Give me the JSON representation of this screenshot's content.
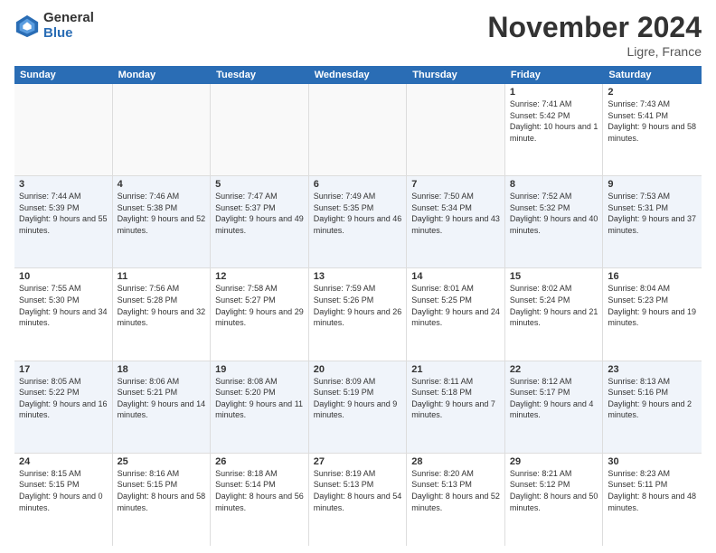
{
  "header": {
    "logo_general": "General",
    "logo_blue": "Blue",
    "month": "November 2024",
    "location": "Ligre, France"
  },
  "calendar": {
    "days": [
      "Sunday",
      "Monday",
      "Tuesday",
      "Wednesday",
      "Thursday",
      "Friday",
      "Saturday"
    ],
    "rows": [
      [
        {
          "day": "",
          "text": "",
          "empty": true
        },
        {
          "day": "",
          "text": "",
          "empty": true
        },
        {
          "day": "",
          "text": "",
          "empty": true
        },
        {
          "day": "",
          "text": "",
          "empty": true
        },
        {
          "day": "",
          "text": "",
          "empty": true
        },
        {
          "day": "1",
          "text": "Sunrise: 7:41 AM\nSunset: 5:42 PM\nDaylight: 10 hours and 1 minute.",
          "empty": false
        },
        {
          "day": "2",
          "text": "Sunrise: 7:43 AM\nSunset: 5:41 PM\nDaylight: 9 hours and 58 minutes.",
          "empty": false
        }
      ],
      [
        {
          "day": "3",
          "text": "Sunrise: 7:44 AM\nSunset: 5:39 PM\nDaylight: 9 hours and 55 minutes.",
          "empty": false
        },
        {
          "day": "4",
          "text": "Sunrise: 7:46 AM\nSunset: 5:38 PM\nDaylight: 9 hours and 52 minutes.",
          "empty": false
        },
        {
          "day": "5",
          "text": "Sunrise: 7:47 AM\nSunset: 5:37 PM\nDaylight: 9 hours and 49 minutes.",
          "empty": false
        },
        {
          "day": "6",
          "text": "Sunrise: 7:49 AM\nSunset: 5:35 PM\nDaylight: 9 hours and 46 minutes.",
          "empty": false
        },
        {
          "day": "7",
          "text": "Sunrise: 7:50 AM\nSunset: 5:34 PM\nDaylight: 9 hours and 43 minutes.",
          "empty": false
        },
        {
          "day": "8",
          "text": "Sunrise: 7:52 AM\nSunset: 5:32 PM\nDaylight: 9 hours and 40 minutes.",
          "empty": false
        },
        {
          "day": "9",
          "text": "Sunrise: 7:53 AM\nSunset: 5:31 PM\nDaylight: 9 hours and 37 minutes.",
          "empty": false
        }
      ],
      [
        {
          "day": "10",
          "text": "Sunrise: 7:55 AM\nSunset: 5:30 PM\nDaylight: 9 hours and 34 minutes.",
          "empty": false
        },
        {
          "day": "11",
          "text": "Sunrise: 7:56 AM\nSunset: 5:28 PM\nDaylight: 9 hours and 32 minutes.",
          "empty": false
        },
        {
          "day": "12",
          "text": "Sunrise: 7:58 AM\nSunset: 5:27 PM\nDaylight: 9 hours and 29 minutes.",
          "empty": false
        },
        {
          "day": "13",
          "text": "Sunrise: 7:59 AM\nSunset: 5:26 PM\nDaylight: 9 hours and 26 minutes.",
          "empty": false
        },
        {
          "day": "14",
          "text": "Sunrise: 8:01 AM\nSunset: 5:25 PM\nDaylight: 9 hours and 24 minutes.",
          "empty": false
        },
        {
          "day": "15",
          "text": "Sunrise: 8:02 AM\nSunset: 5:24 PM\nDaylight: 9 hours and 21 minutes.",
          "empty": false
        },
        {
          "day": "16",
          "text": "Sunrise: 8:04 AM\nSunset: 5:23 PM\nDaylight: 9 hours and 19 minutes.",
          "empty": false
        }
      ],
      [
        {
          "day": "17",
          "text": "Sunrise: 8:05 AM\nSunset: 5:22 PM\nDaylight: 9 hours and 16 minutes.",
          "empty": false
        },
        {
          "day": "18",
          "text": "Sunrise: 8:06 AM\nSunset: 5:21 PM\nDaylight: 9 hours and 14 minutes.",
          "empty": false
        },
        {
          "day": "19",
          "text": "Sunrise: 8:08 AM\nSunset: 5:20 PM\nDaylight: 9 hours and 11 minutes.",
          "empty": false
        },
        {
          "day": "20",
          "text": "Sunrise: 8:09 AM\nSunset: 5:19 PM\nDaylight: 9 hours and 9 minutes.",
          "empty": false
        },
        {
          "day": "21",
          "text": "Sunrise: 8:11 AM\nSunset: 5:18 PM\nDaylight: 9 hours and 7 minutes.",
          "empty": false
        },
        {
          "day": "22",
          "text": "Sunrise: 8:12 AM\nSunset: 5:17 PM\nDaylight: 9 hours and 4 minutes.",
          "empty": false
        },
        {
          "day": "23",
          "text": "Sunrise: 8:13 AM\nSunset: 5:16 PM\nDaylight: 9 hours and 2 minutes.",
          "empty": false
        }
      ],
      [
        {
          "day": "24",
          "text": "Sunrise: 8:15 AM\nSunset: 5:15 PM\nDaylight: 9 hours and 0 minutes.",
          "empty": false
        },
        {
          "day": "25",
          "text": "Sunrise: 8:16 AM\nSunset: 5:15 PM\nDaylight: 8 hours and 58 minutes.",
          "empty": false
        },
        {
          "day": "26",
          "text": "Sunrise: 8:18 AM\nSunset: 5:14 PM\nDaylight: 8 hours and 56 minutes.",
          "empty": false
        },
        {
          "day": "27",
          "text": "Sunrise: 8:19 AM\nSunset: 5:13 PM\nDaylight: 8 hours and 54 minutes.",
          "empty": false
        },
        {
          "day": "28",
          "text": "Sunrise: 8:20 AM\nSunset: 5:13 PM\nDaylight: 8 hours and 52 minutes.",
          "empty": false
        },
        {
          "day": "29",
          "text": "Sunrise: 8:21 AM\nSunset: 5:12 PM\nDaylight: 8 hours and 50 minutes.",
          "empty": false
        },
        {
          "day": "30",
          "text": "Sunrise: 8:23 AM\nSunset: 5:11 PM\nDaylight: 8 hours and 48 minutes.",
          "empty": false
        }
      ]
    ]
  }
}
